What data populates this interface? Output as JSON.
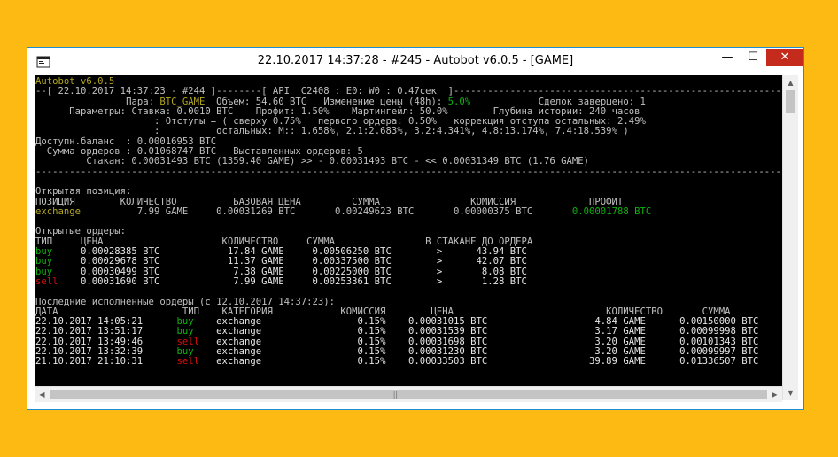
{
  "window": {
    "title": "22.10.2017 14:37:28 - #245 - Autobot v6.0.5 - [GAME]",
    "minimize": "—",
    "maximize": "☐",
    "close": "✕",
    "icon": "console-app-icon"
  },
  "console": {
    "header": {
      "app": "Autobot v6.0.5",
      "status": "--[ 22.10.2017 14:37:23 - #244 ]--------[ API  C2408 : E0: W0 : 0.47сек  ]--------------------------------------------------------------"
    },
    "params": {
      "pair_label": "Пара:",
      "pair_value": "BTC_GAME",
      "volume": "Объем: 54.60 BTC",
      "change_label": "Изменение цены (48h):",
      "change_value": "5.0%",
      "deals_done": "Сделок завершено: 1",
      "line2": "Параметры: Ставка: 0.0010 BTC    Профит: 1.50%    Мартингейл: 50.0%        Глубина истории: 240 часов",
      "line3": "         : Отступы = ( сверху 0.75%   первого ордера: 0.50%   коррекция отступа остальных: 2.49%",
      "line4": "         :          остальных: M:: 1.658%, 2.1:2.683%, 3.2:4.341%, 4.8:13.174%, 7.4:18.539% )",
      "balance": "Доступн.баланс  : 0.00016953 BTC",
      "orders_sum": "  Сумма ордеров : 0.01068747 BTC   Выставленных ордеров: 5",
      "orderbook": "         Стакан: 0.00031493 BTC (1359.40 GAME) >> - 0.00031493 BTC - << 0.00031349 BTC (1.76 GAME)",
      "separator": "------------------------------------------------------------------------------------------------------------------------------------------------"
    },
    "position": {
      "title": "Открытая позиция:",
      "header": "ПОЗИЦИЯ        КОЛИЧЕСТВО          БАЗОВАЯ ЦЕНА         СУММА                КОМИССИЯ             ПРОФИТ",
      "type": "exchange",
      "row": "          7.99 GAME     0.00031269 BTC       0.00249623 BTC       0.00000375 BTC       ",
      "profit": "0.00001788 BTC"
    },
    "open_orders": {
      "title": "Открытые ордеры:",
      "header": "ТИП     ЦЕНА                     КОЛИЧЕСТВО     СУММА                В СТАКАНЕ ДО ОРДЕРА",
      "rows": [
        {
          "side": "buy ",
          "rest": "    0.00028385 BTC            17.84 GAME     0.00506250 BTC        >      43.94 BTC"
        },
        {
          "side": "buy ",
          "rest": "    0.00029678 BTC            11.37 GAME     0.00337500 BTC        >      42.07 BTC"
        },
        {
          "side": "buy ",
          "rest": "    0.00030499 BTC             7.38 GAME     0.00225000 BTC        >       8.08 BTC"
        },
        {
          "side": "sell",
          "rest": "    0.00031690 BTC             7.99 GAME     0.00253361 BTC        >       1.28 BTC"
        }
      ]
    },
    "history": {
      "title": "Последние исполненные ордеры (с 12.10.2017 14:37:23):",
      "header": "ДАТА                      ТИП    КАТЕГОРИЯ            КОМИССИЯ        ЦЕНА                           КОЛИЧЕСТВО       СУММА",
      "rows": [
        {
          "date": "22.10.2017 14:05:21      ",
          "side": "buy ",
          "rest": "   exchange                 0.15%    0.00031015 BTC                   4.84 GAME      0.00150000 BTC"
        },
        {
          "date": "22.10.2017 13:51:17      ",
          "side": "buy ",
          "rest": "   exchange                 0.15%    0.00031539 BTC                   3.17 GAME      0.00099998 BTC"
        },
        {
          "date": "22.10.2017 13:49:46      ",
          "side": "sell",
          "rest": "   exchange                 0.15%    0.00031698 BTC                   3.20 GAME      0.00101343 BTC"
        },
        {
          "date": "22.10.2017 13:32:39      ",
          "side": "buy ",
          "rest": "   exchange                 0.15%    0.00031230 BTC                   3.20 GAME      0.00099997 BTC"
        },
        {
          "date": "21.10.2017 21:10:31      ",
          "side": "sell",
          "rest": "   exchange                 0.15%    0.00033503 BTC                  39.89 GAME      0.01336507 BTC"
        }
      ]
    },
    "cursor": "_"
  },
  "scroll": {
    "up": "▲",
    "down": "▼",
    "left": "◀",
    "right": "▶",
    "grip": "|||"
  },
  "colors": {
    "background": "#FDBA12",
    "console_bg": "#000000",
    "console_text": "#c0c0c0",
    "highlight_yellow": "#b0a520",
    "buy_green": "#10b010",
    "sell_red": "#d01010",
    "close_button": "#c42b1c"
  }
}
